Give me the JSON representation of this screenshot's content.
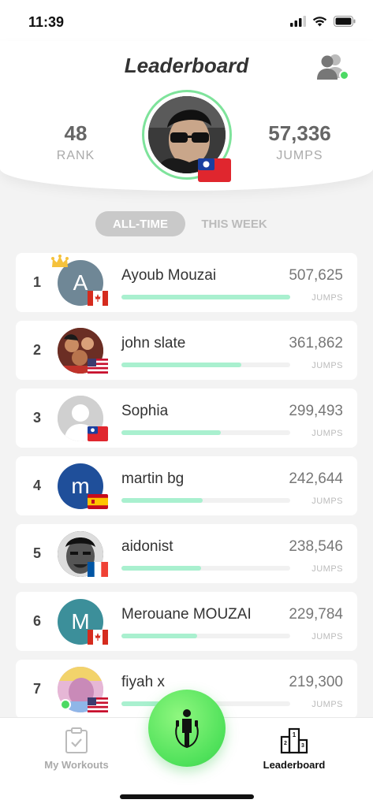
{
  "status_bar": {
    "time": "11:39"
  },
  "header": {
    "title": "Leaderboard",
    "rank_value": "48",
    "rank_label": "RANK",
    "jumps_value": "57,336",
    "jumps_label": "JUMPS"
  },
  "tabs": {
    "all_time": "ALL-TIME",
    "this_week": "THIS WEEK",
    "active": "ALL-TIME"
  },
  "colors": {
    "accent_green": "#4fe15a",
    "progress_bar": "#a9f0cf",
    "online_dot": "#4cd964"
  },
  "leaderboard": [
    {
      "rank": "1",
      "name": "Ayoub Mouzai",
      "jumps": "507,625",
      "unit": "JUMPS",
      "initial": "A",
      "avatar_color": "#6f8796",
      "flag": "canada",
      "progress": 1.0,
      "crown": true
    },
    {
      "rank": "2",
      "name": "john slate",
      "jumps": "361,862",
      "unit": "JUMPS",
      "initial": "",
      "avatar_color": "#8a4a3a",
      "flag": "usa",
      "progress": 0.71
    },
    {
      "rank": "3",
      "name": "Sophia",
      "jumps": "299,493",
      "unit": "JUMPS",
      "initial": "",
      "avatar_color": "#c8c8c8",
      "flag": "taiwan",
      "progress": 0.59
    },
    {
      "rank": "4",
      "name": "martin bg",
      "jumps": "242,644",
      "unit": "JUMPS",
      "initial": "m",
      "avatar_color": "#1f4f9a",
      "flag": "spain",
      "progress": 0.48
    },
    {
      "rank": "5",
      "name": "aidonist",
      "jumps": "238,546",
      "unit": "JUMPS",
      "initial": "",
      "avatar_color": "#333333",
      "flag": "france",
      "progress": 0.47
    },
    {
      "rank": "6",
      "name": "Merouane MOUZAI",
      "jumps": "229,784",
      "unit": "JUMPS",
      "initial": "M",
      "avatar_color": "#3c8f9a",
      "flag": "canada",
      "progress": 0.45
    },
    {
      "rank": "7",
      "name": "fiyah x",
      "jumps": "219,300",
      "unit": "JUMPS",
      "initial": "",
      "avatar_color": "#d8a0c8",
      "flag": "usa",
      "progress": 0.43,
      "online": true
    }
  ],
  "tabbar": {
    "workouts_label": "My Workouts",
    "leaderboard_label": "Leaderboard",
    "icons": {
      "workouts": "clipboard-check-icon",
      "center": "jump-rope-icon",
      "leaderboard": "podium-icon"
    }
  }
}
